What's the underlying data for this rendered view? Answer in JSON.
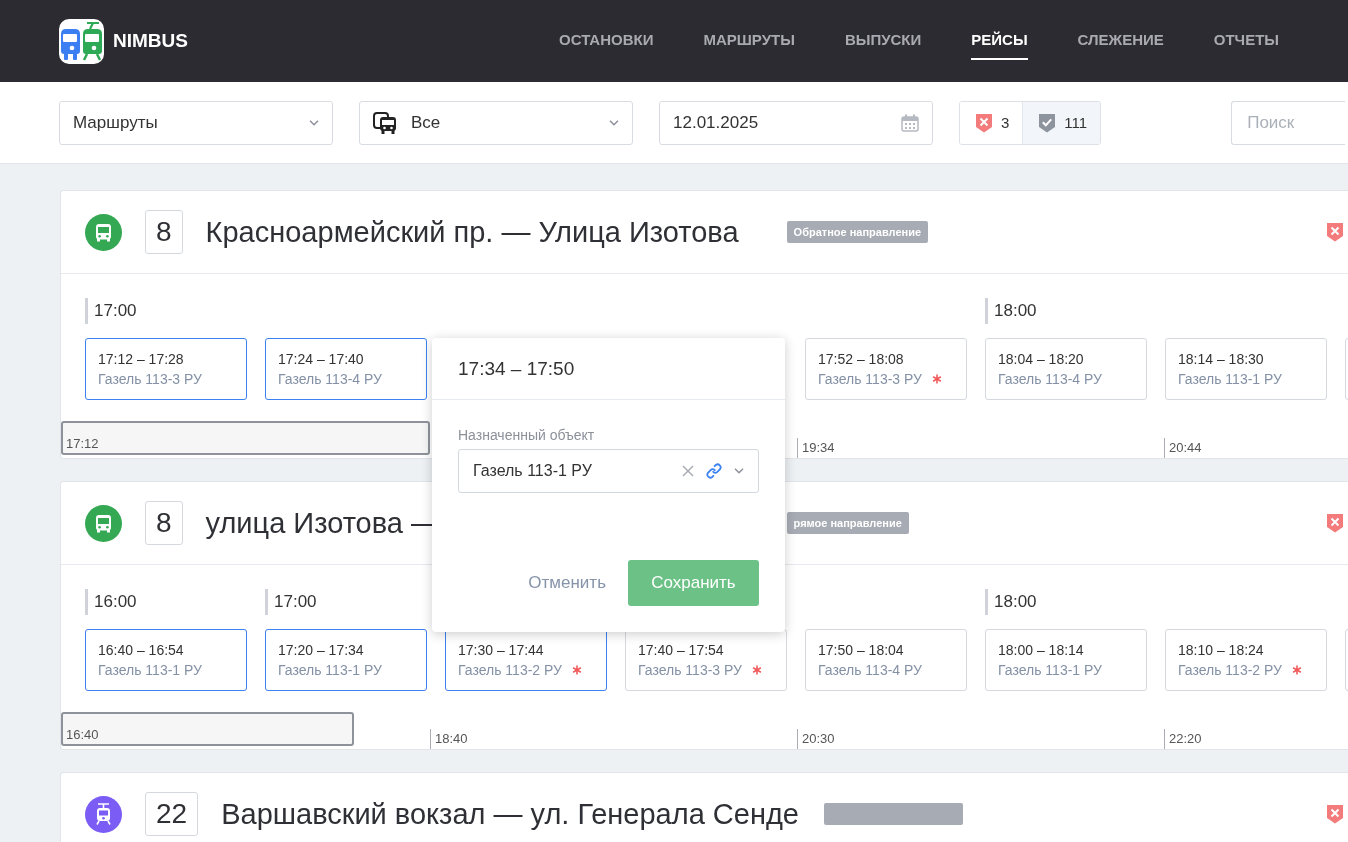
{
  "header": {
    "brand": "NIMBUS",
    "nav": [
      {
        "label": "ОСТАНОВКИ",
        "selected": false
      },
      {
        "label": "МАРШРУТЫ",
        "selected": false
      },
      {
        "label": "ВЫПУСКИ",
        "selected": false
      },
      {
        "label": "РЕЙСЫ",
        "selected": true
      },
      {
        "label": "СЛЕЖЕНИЕ",
        "selected": false
      },
      {
        "label": "ОТЧЕТЫ",
        "selected": false
      }
    ]
  },
  "filters": {
    "route_select": {
      "value": "Маршруты"
    },
    "type_select": {
      "value": "Все"
    },
    "date_field": {
      "value": "12.01.2025"
    },
    "status_toggles": [
      {
        "kind": "issues",
        "count": "3",
        "selected": false
      },
      {
        "kind": "ok",
        "count": "111",
        "selected": true
      }
    ],
    "search": {
      "placeholder": "Поиск"
    }
  },
  "routes": [
    {
      "kind": "bus",
      "color": "#34a853",
      "number": "8",
      "title": "Красноармейский пр. — Улица Изотова",
      "badge": {
        "kind": "direction",
        "text": "Обратное направление"
      },
      "issues": true,
      "trips": [
        {
          "kind": "trip",
          "hour": "17:00",
          "time": "17:12 – 17:28",
          "vehicle": "Газель 113-3 РУ",
          "selected": true,
          "flagged": false
        },
        {
          "kind": "trip",
          "time": "17:24 – 17:40",
          "vehicle": "Газель 113-4 РУ",
          "selected": true,
          "flagged": false
        },
        {
          "kind": "editor",
          "title": "17:34 – 17:50",
          "field_label": "Назначенный объект",
          "field_value": "Газель 113-1 РУ",
          "buttons": [
            {
              "kind": "secondary",
              "label": "Отменить"
            },
            {
              "kind": "primary",
              "label": "Сохранить"
            }
          ]
        },
        {
          "kind": "trip",
          "time": "17:52 – 18:08",
          "vehicle": "Газель 113-3 РУ",
          "selected": false,
          "flagged": true
        },
        {
          "kind": "trip",
          "hour": "18:00",
          "time": "18:04 – 18:20",
          "vehicle": "Газель 113-4 РУ",
          "selected": false,
          "flagged": false
        },
        {
          "kind": "trip",
          "time": "18:14 – 18:30",
          "vehicle": "Газель 113-1 РУ",
          "selected": false,
          "flagged": false
        },
        {
          "kind": "trip",
          "selected": false
        }
      ],
      "overview": {
        "window_label": "17:12",
        "level": 0.287,
        "ticks": [
          "19:34",
          "20:44"
        ]
      }
    },
    {
      "kind": "bus",
      "color": "#34a853",
      "number": "8",
      "title": "улица Изотова —",
      "badge": {
        "kind": "direction",
        "text": "рямое направление"
      },
      "issues": true,
      "trips": [
        {
          "kind": "trip",
          "hour": "16:00",
          "time": "16:40 – 16:54",
          "vehicle": "Газель 113-1 РУ",
          "selected": true,
          "flagged": false
        },
        {
          "kind": "trip",
          "hour": "17:00",
          "time": "17:20 – 17:34",
          "vehicle": "Газель 113-1 РУ",
          "selected": true,
          "flagged": false
        },
        {
          "kind": "trip",
          "time": "17:30 – 17:44",
          "vehicle": "Газель 113-2 РУ",
          "selected": true,
          "flagged": true
        },
        {
          "kind": "trip",
          "time": "17:40 – 17:54",
          "vehicle": "Газель 113-3 РУ",
          "selected": false,
          "flagged": true
        },
        {
          "kind": "trip",
          "time": "17:50 – 18:04",
          "vehicle": "Газель 113-4 РУ",
          "selected": false,
          "flagged": false
        },
        {
          "kind": "trip",
          "hour": "18:00",
          "time": "18:00 – 18:14",
          "vehicle": "Газель 113-1 РУ",
          "selected": false,
          "flagged": false
        },
        {
          "kind": "trip",
          "time": "18:10 – 18:24",
          "vehicle": "Газель 113-2 РУ",
          "selected": false,
          "flagged": true
        },
        {
          "kind": "trip",
          "selected": false
        }
      ],
      "overview": {
        "window_label": "16:40",
        "level": 0.228,
        "ticks": [
          "18:40",
          "20:30",
          "22:20"
        ]
      }
    },
    {
      "kind": "tram",
      "color": "#7b5cf5",
      "number": "22",
      "title": "Варшавский вокзал — ул. Генерала Сенде",
      "badge": {
        "kind": "direction"
      },
      "issues": true
    }
  ]
}
